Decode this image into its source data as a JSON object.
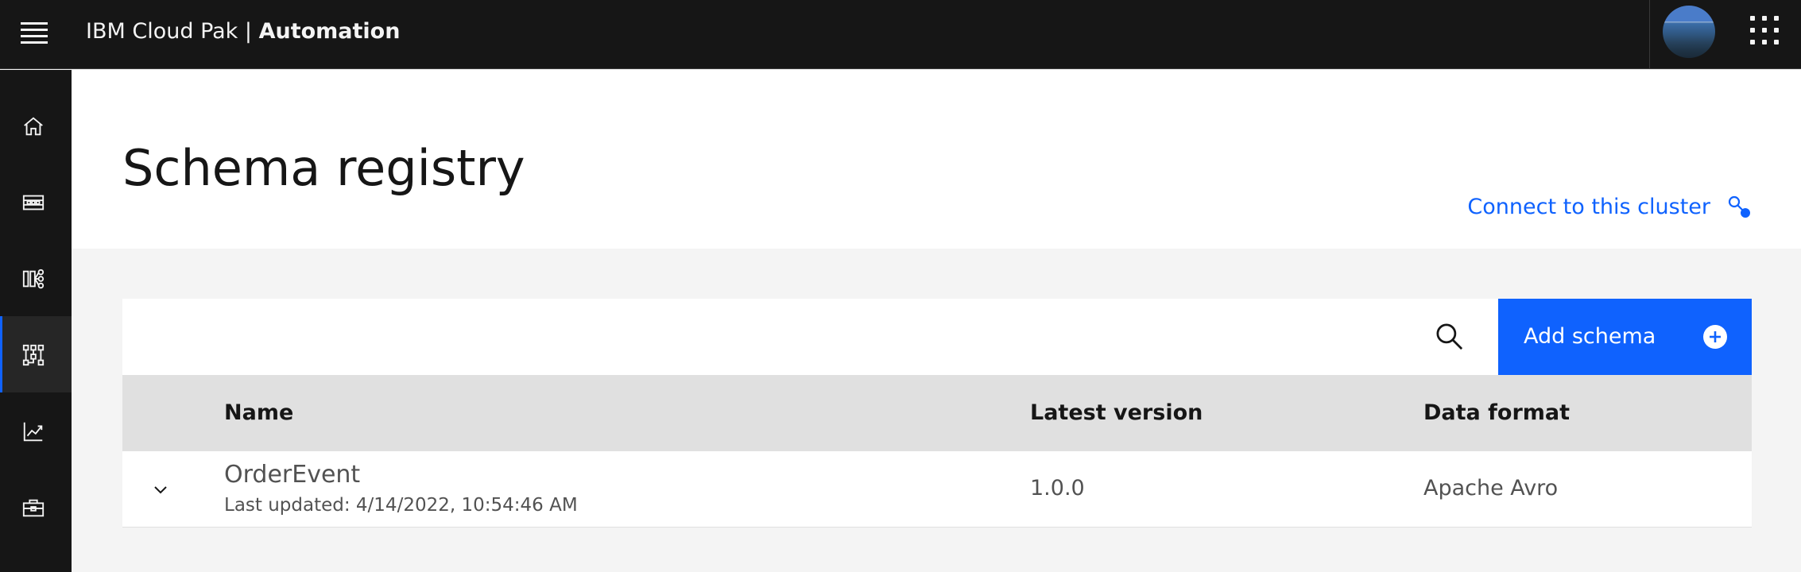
{
  "header": {
    "brand_prefix": "IBM Cloud Pak | ",
    "brand_product": "Automation"
  },
  "rail": {
    "items": [
      {
        "icon": "home-icon"
      },
      {
        "icon": "topics-icon"
      },
      {
        "icon": "consumer-groups-icon"
      },
      {
        "icon": "schema-registry-icon",
        "active": true
      },
      {
        "icon": "monitoring-icon"
      },
      {
        "icon": "toolbox-icon"
      }
    ]
  },
  "page": {
    "title": "Schema registry",
    "connect_label": "Connect to this cluster"
  },
  "toolbar": {
    "add_label": "Add schema"
  },
  "table": {
    "headers": {
      "name": "Name",
      "version": "Latest version",
      "format": "Data format"
    },
    "rows": [
      {
        "name": "OrderEvent",
        "updated": "Last updated: 4/14/2022, 10:54:46 AM",
        "version": "1.0.0",
        "format": "Apache Avro"
      }
    ]
  },
  "colors": {
    "primary": "#0f62fe",
    "header_bg": "#161616",
    "table_header_bg": "#e0e0e0"
  }
}
